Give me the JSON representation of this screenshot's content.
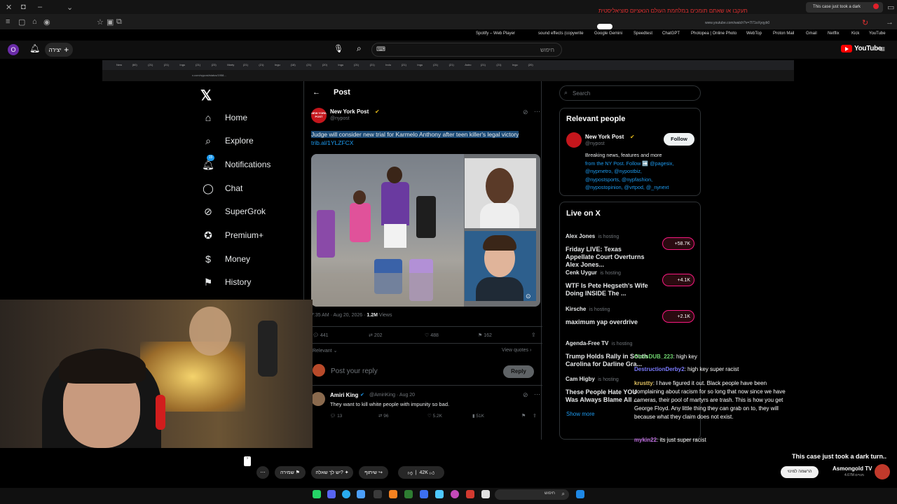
{
  "browser": {
    "top_notice": "תעקבו או שאתם תומכים במלחמת העולם הנאציזם סוציאליסטית",
    "tab_title": "This case just took a dark",
    "url": "www.youtube.com/watch?v=7l71oXyqyb0",
    "bookmarks": [
      "Spotify – Web Player",
      "sound effects (copywrite",
      "Google Gemini",
      "Speedtest",
      "ChatGPT",
      "Photopea | Online Photo",
      "WebTop",
      "Proton Mail",
      "Gmail",
      "Netflix",
      "Kick",
      "YouTube"
    ]
  },
  "youtube": {
    "create_label": "יצירה",
    "search_placeholder": "חיפוש",
    "logo_text": "YouTube",
    "avatar_letter": "O"
  },
  "inner_browser": {
    "url": "x.com/nypost/status/1958...",
    "tabs": [
      "New",
      "(60)",
      "(21)",
      "(21)",
      "Ingu",
      "(21)",
      "(23)",
      "Marty",
      "(21)",
      "(21)",
      "Ingu",
      "(18)",
      "(21)",
      "(20)",
      "Ingu",
      "(21)",
      "(21)",
      "Indu",
      "(21)",
      "Ingu",
      "(21)",
      "(21)",
      "Astro",
      "(21)",
      "(21)",
      "Ingu",
      "(20)"
    ]
  },
  "x_nav": {
    "items": [
      {
        "label": "Home",
        "icon": "home-icon"
      },
      {
        "label": "Explore",
        "icon": "search-icon"
      },
      {
        "label": "Notifications",
        "icon": "bell-icon",
        "badge": "15"
      },
      {
        "label": "Chat",
        "icon": "chat-icon"
      },
      {
        "label": "SuperGrok",
        "icon": "grok-icon"
      },
      {
        "label": "Premium+",
        "icon": "verified-icon"
      },
      {
        "label": "Money",
        "icon": "dollar-icon"
      },
      {
        "label": "History",
        "icon": "bookmark-icon"
      }
    ]
  },
  "post": {
    "header": "Post",
    "author_name": "New York Post",
    "author_handle": "@nypost",
    "avatar_text": "NEW YORK POST",
    "text": "Judge will consider new trial for Karmelo Anthony after teen killer's legal victory",
    "link": "trib.al/1YLZFCX",
    "timestamp": "7:35 AM · Aug 20, 2026 · ",
    "views_count": "1.2M",
    "views_label": "Views",
    "stats": {
      "replies": "441",
      "reposts": "202",
      "likes": "488",
      "bookmarks": "162"
    },
    "relevant_label": "Relevant",
    "view_quotes": "View quotes",
    "reply_placeholder": "Post your reply",
    "reply_button": "Reply"
  },
  "reply": {
    "name": "Amiri King",
    "handle": "@AmiriKing · Aug 20",
    "text": "They want to kill white people with impunity so bad.",
    "stats": {
      "replies": "13",
      "reposts": "96",
      "likes": "5.2K",
      "views": "51K"
    }
  },
  "sidebar_right": {
    "search_placeholder": "Search",
    "relevant_title": "Relevant people",
    "rp_name": "New York Post",
    "rp_handle": "@nypost",
    "follow": "Follow",
    "bio_line1": "Breaking news, features and more",
    "bio_line2": "from the NY Post. Follow ➡️ @pagesix,",
    "bio_line3": "@nypmetro, @nypostbiz,",
    "bio_line4": "@nypostsports, @nypfashion,",
    "bio_line5": "@nypostopinion, @vrtpod, @_nynext",
    "live_title": "Live on X",
    "hosting": "is hosting",
    "live": [
      {
        "host": "Alex Jones",
        "title": "Friday LIVE: Texas Appellate Court Overturns Alex Jones...",
        "count": "+58.7K"
      },
      {
        "host": "Cenk Uygur",
        "title": "WTF Is Pete Hegseth's Wife Doing INSIDE The ...",
        "count": "+4.1K"
      },
      {
        "host": "Kirsche",
        "title": "maximum yap overdrive",
        "count": "+2.1K"
      },
      {
        "host": "Agenda-Free TV",
        "title": "Trump Holds Rally in South Carolina for Darline Gra...",
        "count": ""
      },
      {
        "host": "Cam Higby",
        "title": "These People Hate YOU Was Always Blame All ...",
        "count": ""
      }
    ],
    "show_more": "Show more"
  },
  "chat": [
    {
      "name": "ChrisDUB_223",
      "color": "#6fd36f",
      "msg": "high key"
    },
    {
      "name": "DestructionDerby2",
      "color": "#7b7bff",
      "msg": "high key super racist"
    },
    {
      "name": "krustty",
      "color": "#e0c060",
      "msg": "I have figured it out. Black people have been complaining about racism for so long that now since we have cameras, their pool of martyrs are trash. This is how you get George Floyd. Any little thing they can grab on to, they will because what they claim does not exist."
    },
    {
      "name": "mykin22",
      "color": "#c070e0",
      "msg": "its just super racist"
    }
  ],
  "video_meta": {
    "title": "This case just took a dark turn..",
    "channel": "Asmongold TV",
    "subs": "4.67M מנויים",
    "subscribe": "הרשמה למינוי",
    "save": "שמירה",
    "ask": "יש לך שאלה?",
    "share": "שיתוף",
    "likes": "42K"
  },
  "taskbar": {
    "search": "חיפוש"
  }
}
